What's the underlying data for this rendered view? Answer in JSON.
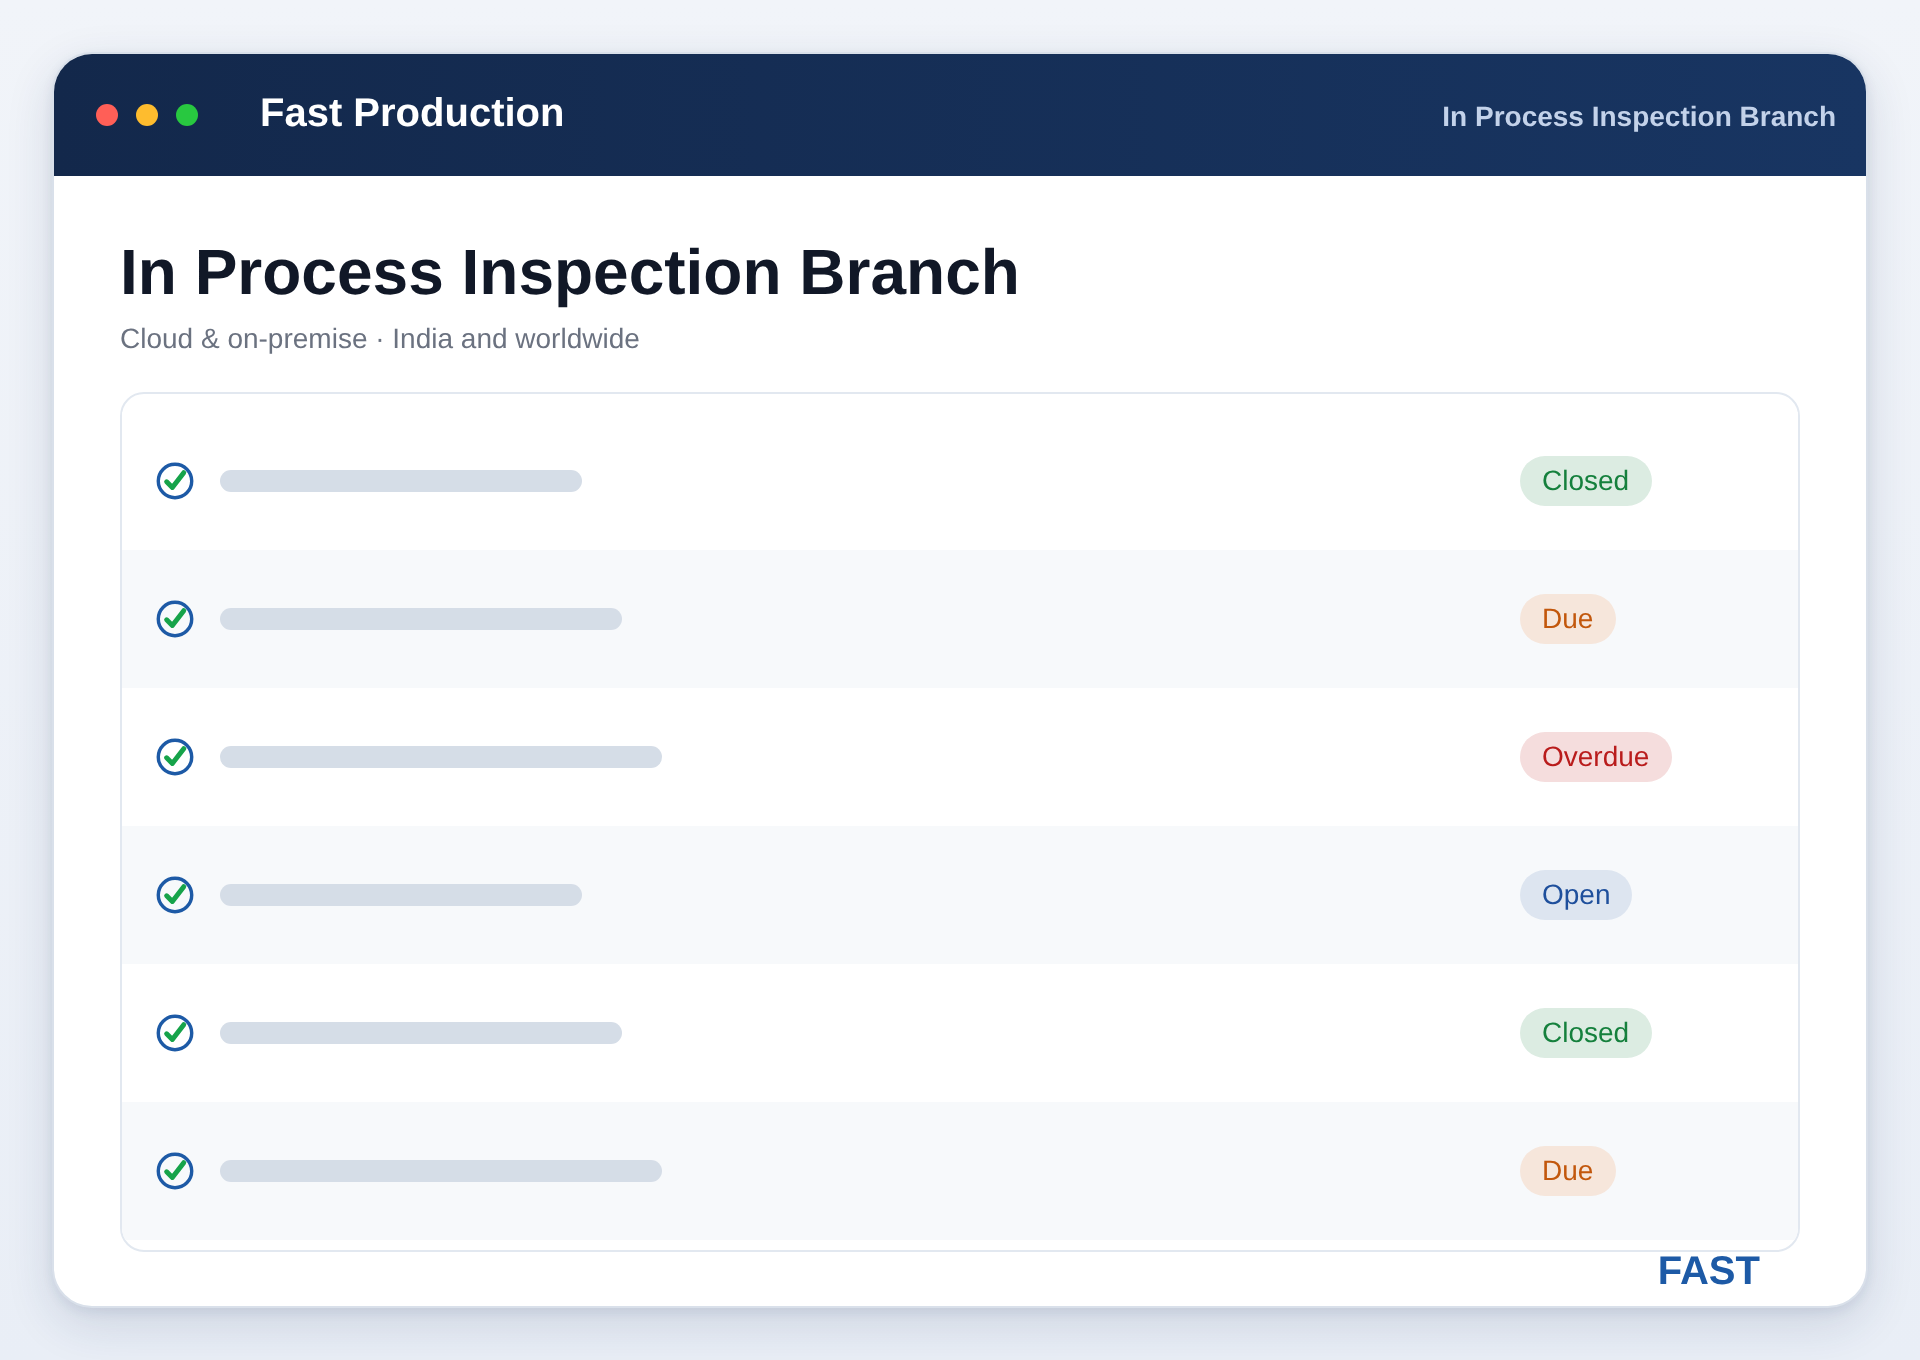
{
  "window": {
    "title": "Fast Production",
    "context": "In Process Inspection Branch"
  },
  "page": {
    "heading": "In Process Inspection Branch",
    "subtitle": "Cloud & on-premise · India and worldwide"
  },
  "rows": [
    {
      "status": "Closed",
      "color": "#15803d"
    },
    {
      "status": "Due",
      "color": "#c2570c"
    },
    {
      "status": "Overdue",
      "color": "#b91c1c"
    },
    {
      "status": "Open",
      "color": "#1e4f9c"
    },
    {
      "status": "Closed",
      "color": "#15803d"
    },
    {
      "status": "Due",
      "color": "#c2570c"
    }
  ],
  "footer": {
    "logo": "FAST"
  }
}
